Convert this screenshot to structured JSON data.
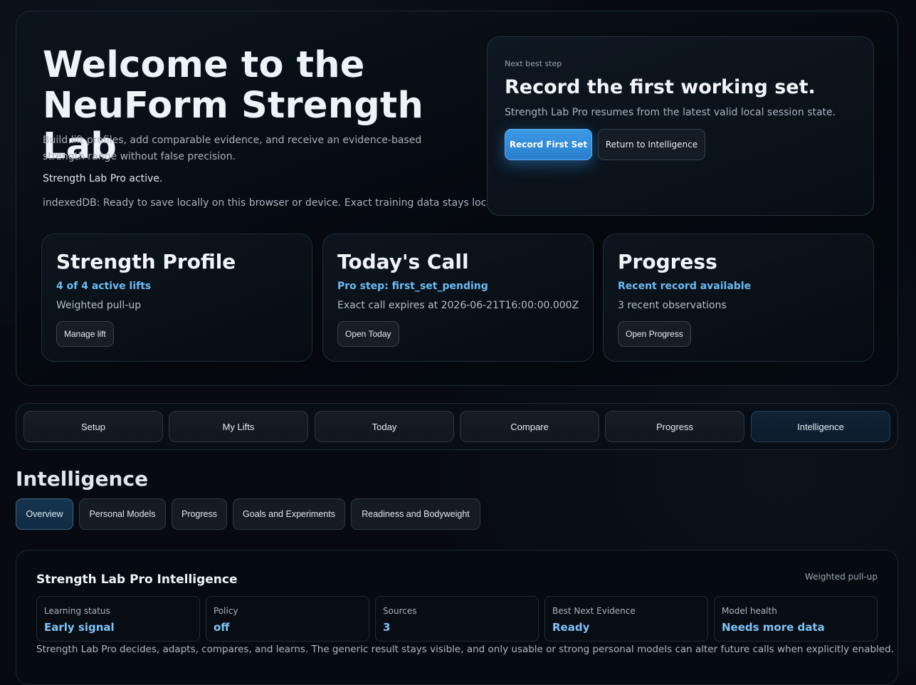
{
  "hero": {
    "title": "Welcome to the NeuForm Strength Lab",
    "description": "Build lift profiles, add comparable evidence, and receive an evidence-based strength range without false precision.",
    "pro_status": "Strength Lab Pro active.",
    "storage": "indexedDB: Ready to save locally on this browser or device. Exact training data stays local."
  },
  "next_step": {
    "eyebrow": "Next best step",
    "title": "Record the first working set.",
    "subtitle": "Strength Lab Pro resumes from the latest valid local session state.",
    "primary_label": "Record First Set",
    "secondary_label": "Return to Intelligence"
  },
  "cards": [
    {
      "title": "Strength Profile",
      "accent": "4 of 4 active lifts",
      "detail": "Weighted pull-up",
      "button": "Manage lift"
    },
    {
      "title": "Today's Call",
      "accent": "Pro step: first_set_pending",
      "detail": "Exact call expires at 2026-06-21T16:00:00.000Z",
      "button": "Open Today"
    },
    {
      "title": "Progress",
      "accent": "Recent record available",
      "detail": "3 recent observations",
      "button": "Open Progress"
    }
  ],
  "nav": {
    "tabs": [
      "Setup",
      "My Lifts",
      "Today",
      "Compare",
      "Progress",
      "Intelligence"
    ],
    "active": "Intelligence"
  },
  "intelligence": {
    "heading": "Intelligence",
    "subtabs": [
      "Overview",
      "Personal Models",
      "Progress",
      "Goals and Experiments",
      "Readiness and Bodyweight"
    ],
    "active_subtab": "Overview",
    "panel": {
      "title": "Strength Lab Pro Intelligence",
      "lift": "Weighted pull-up",
      "metrics": [
        {
          "label": "Learning status",
          "value": "Early signal"
        },
        {
          "label": "Policy",
          "value": "off"
        },
        {
          "label": "Sources",
          "value": "3"
        },
        {
          "label": "Best Next Evidence",
          "value": "Ready"
        },
        {
          "label": "Model health",
          "value": "Needs more data"
        }
      ],
      "note": "Strength Lab Pro decides, adapts, compares, and learns. The generic result stays visible, and only usable or strong personal models can alter future calls when explicitly enabled."
    }
  },
  "colors": {
    "accent": "#6cbcf5",
    "primary_button": "#3391dc",
    "background": "#070b11"
  }
}
